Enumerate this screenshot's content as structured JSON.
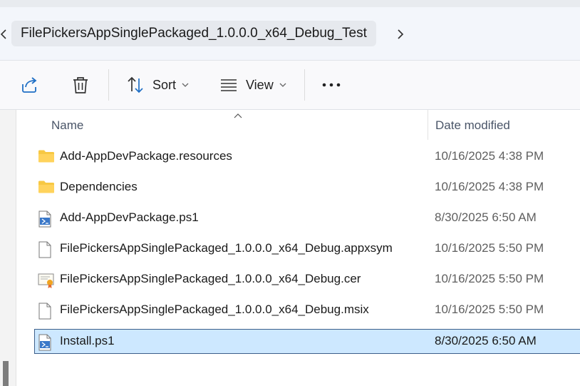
{
  "address_bar": {
    "crumb": "FilePickersAppSinglePackaged_1.0.0.0_x64_Debug_Test"
  },
  "toolbar": {
    "sort_label": "Sort",
    "view_label": "View"
  },
  "columns": {
    "name": "Name",
    "date": "Date modified"
  },
  "files": [
    {
      "name": "Add-AppDevPackage.resources",
      "date": "10/16/2025 4:38 PM",
      "icon": "folder-icon"
    },
    {
      "name": "Dependencies",
      "date": "10/16/2025 4:38 PM",
      "icon": "folder-icon"
    },
    {
      "name": "Add-AppDevPackage.ps1",
      "date": "8/30/2025 6:50 AM",
      "icon": "powershell-script-icon"
    },
    {
      "name": "FilePickersAppSinglePackaged_1.0.0.0_x64_Debug.appxsym",
      "date": "10/16/2025 5:50 PM",
      "icon": "file-icon"
    },
    {
      "name": "FilePickersAppSinglePackaged_1.0.0.0_x64_Debug.cer",
      "date": "10/16/2025 5:50 PM",
      "icon": "certificate-icon"
    },
    {
      "name": "FilePickersAppSinglePackaged_1.0.0.0_x64_Debug.msix",
      "date": "10/16/2025 5:50 PM",
      "icon": "file-icon"
    },
    {
      "name": "Install.ps1",
      "date": "8/30/2025 6:50 AM",
      "icon": "powershell-script-icon",
      "selected": true
    }
  ],
  "colors": {
    "selection_bg": "#cde8ff",
    "selection_border": "#3d5f8a",
    "folder": "#f7c843",
    "accent": "#1f6fc5"
  }
}
